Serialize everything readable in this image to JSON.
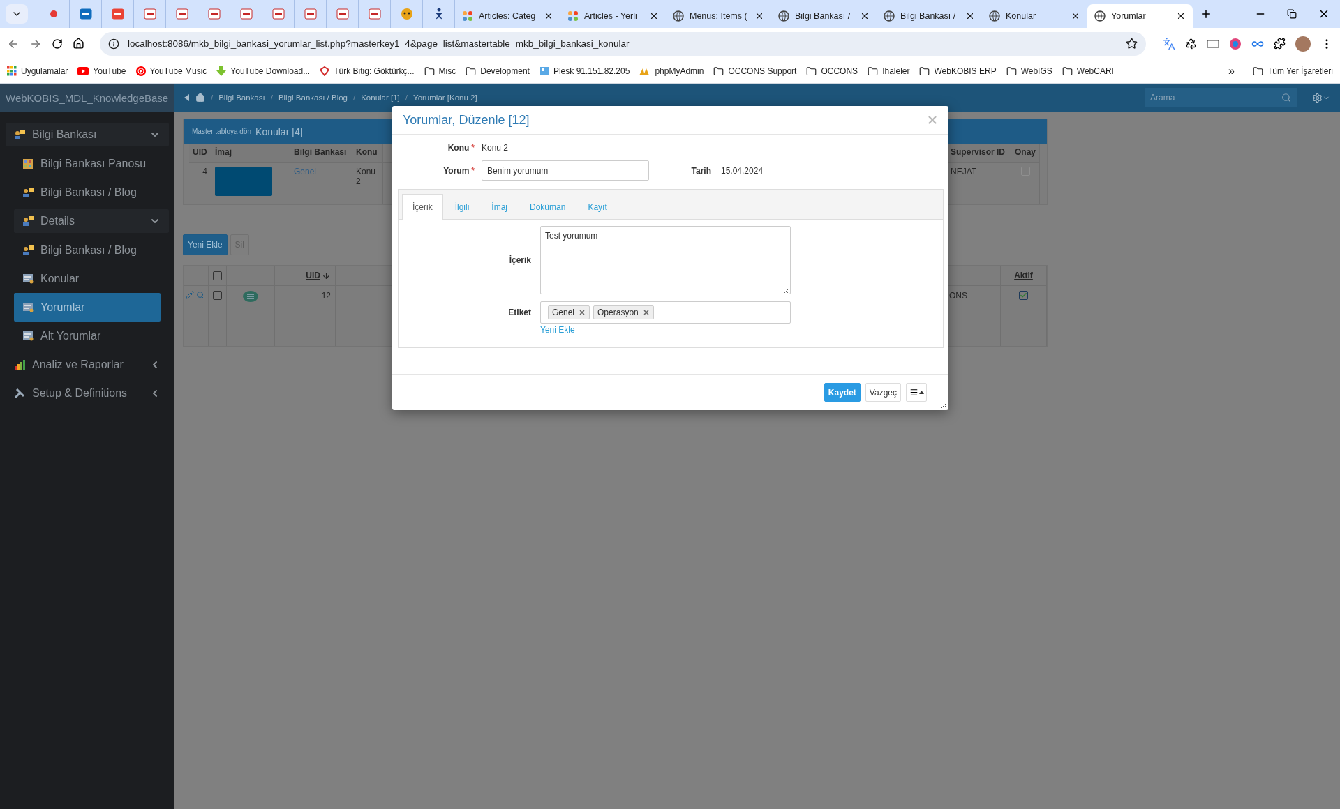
{
  "browser": {
    "tabs": [
      {
        "kind": "pinned",
        "selected": false
      },
      {
        "kind": "pinned",
        "selected": false
      },
      {
        "kind": "pinned",
        "selected": false
      },
      {
        "kind": "pinned",
        "selected": false
      },
      {
        "kind": "pinned",
        "selected": false
      },
      {
        "kind": "pinned",
        "selected": false
      },
      {
        "kind": "pinned",
        "selected": false
      },
      {
        "kind": "pinned",
        "selected": false
      },
      {
        "kind": "pinned",
        "selected": false
      },
      {
        "kind": "pinned",
        "selected": false
      },
      {
        "kind": "pinned",
        "selected": false
      },
      {
        "kind": "pinned",
        "selected": false
      },
      {
        "kind": "pinned",
        "selected": false
      },
      {
        "kind": "titled",
        "title": "Articles: Categ",
        "selected": false
      },
      {
        "kind": "titled",
        "title": "Articles - Yerli",
        "selected": false
      },
      {
        "kind": "titled",
        "title": "Menus: Items (",
        "selected": false
      },
      {
        "kind": "titled",
        "title": "Bilgi Bankası /",
        "selected": false
      },
      {
        "kind": "titled",
        "title": "Bilgi Bankası /",
        "selected": false
      },
      {
        "kind": "titled",
        "title": "Konular",
        "selected": false
      },
      {
        "kind": "titled",
        "title": "Yorumlar",
        "selected": true
      }
    ],
    "url": "localhost:8086/mkb_bilgi_bankasi_yorumlar_list.php?masterkey1=4&page=list&mastertable=mkb_bilgi_bankasi_konular",
    "bookmarks": [
      {
        "kind": "apps",
        "label": "Uygulamalar"
      },
      {
        "kind": "video",
        "label": "YouTube"
      },
      {
        "kind": "music",
        "label": "YouTube Music"
      },
      {
        "kind": "download",
        "label": "YouTube Download..."
      },
      {
        "kind": "site",
        "label": "Türk Bitig: Göktürkç..."
      },
      {
        "kind": "folder",
        "label": "Misc"
      },
      {
        "kind": "folder",
        "label": "Development"
      },
      {
        "kind": "server",
        "label": "Plesk 91.151.82.205"
      },
      {
        "kind": "database",
        "label": "phpMyAdmin"
      },
      {
        "kind": "folder",
        "label": "OCCONS Support"
      },
      {
        "kind": "folder",
        "label": "OCCONS"
      },
      {
        "kind": "folder",
        "label": "Ihaleler"
      },
      {
        "kind": "folder",
        "label": "WebKOBIS ERP"
      },
      {
        "kind": "folder",
        "label": "WebIGS"
      },
      {
        "kind": "folder",
        "label": "WebCARI"
      }
    ],
    "overflow": "»",
    "all_bookmarks": "Tüm Yer İşaretleri"
  },
  "app": {
    "brand": "WebKOBIS_MDL_KnowledgeBase",
    "breadcrumb_separator": "/",
    "breadcrumb": [
      "Bilgi Bankası",
      "Bilgi Bankası / Blog",
      "Konular [1]",
      "Yorumlar [Konu 2]"
    ],
    "search": {
      "placeholder": "Arama"
    }
  },
  "sidebar": {
    "items": [
      {
        "label": "Bilgi Bankası",
        "kind": "module",
        "expanded": true,
        "selected": false,
        "children": [
          {
            "label": "Bilgi Bankası Panosu",
            "kind": "dashboard",
            "selected": false
          },
          {
            "label": "Bilgi Bankası / Blog",
            "kind": "module",
            "selected": false
          },
          {
            "label": "Details",
            "kind": "module",
            "expanded": true,
            "selected": false,
            "children": [
              {
                "label": "Bilgi Bankası / Blog",
                "kind": "module",
                "selected": false
              },
              {
                "label": "Konular",
                "kind": "form",
                "selected": false
              },
              {
                "label": "Yorumlar",
                "kind": "form",
                "selected": true
              },
              {
                "label": "Alt Yorumlar",
                "kind": "form",
                "selected": false
              }
            ]
          }
        ]
      },
      {
        "label": "Analiz ve Raporlar",
        "kind": "report",
        "expanded": false,
        "selected": false
      },
      {
        "label": "Setup & Definitions",
        "kind": "setup",
        "expanded": false,
        "selected": false
      }
    ]
  },
  "master_panel": {
    "back_link": "Master tabloya dön",
    "title": "Konular [4]",
    "columns": [
      "UID",
      "İmaj",
      "Bilgi Bankası",
      "Konu",
      "Supervisor ID",
      "Onay"
    ],
    "row": {
      "uid": "4",
      "bilgi_bankasi": "Genel",
      "konu": "Konu 2",
      "supervisor_id": "NEJAT",
      "onay": {
        "checked": false
      }
    }
  },
  "detail_list": {
    "buttons": [
      "Yeni Ekle",
      "Sil"
    ],
    "columns": {
      "uid": "UID",
      "aktif": "Aktif"
    },
    "header_checkbox": {
      "checked": false
    },
    "rows": [
      {
        "checked": false,
        "uid": "12",
        "column_6": "ONS",
        "aktif": {
          "checked": true
        }
      }
    ]
  },
  "modal": {
    "title": "Yorumlar, Düzenle [12]",
    "fields": [
      {
        "label": "Konu",
        "required_mark": "*",
        "value": "Konu 2"
      },
      {
        "label": "Yorum",
        "required_mark": "*",
        "input": "Benim yorumum"
      },
      {
        "label": "Tarih",
        "value": "15.04.2024"
      }
    ],
    "tabs": [
      {
        "label": "İçerik",
        "selected": true
      },
      {
        "label": "İlgili",
        "selected": false
      },
      {
        "label": "İmaj",
        "selected": false
      },
      {
        "label": "Doküman",
        "selected": false
      },
      {
        "label": "Kayıt",
        "selected": false
      }
    ],
    "content_label": "İçerik",
    "content": "Test yorumum",
    "tag_label": "Etiket",
    "tags": [
      "Genel",
      "Operasyon"
    ],
    "add_tag": "Yeni Ekle",
    "buttons": [
      {
        "label": "Kaydet",
        "kind": "primary"
      },
      {
        "label": "Vazgeç",
        "kind": "default"
      }
    ]
  }
}
